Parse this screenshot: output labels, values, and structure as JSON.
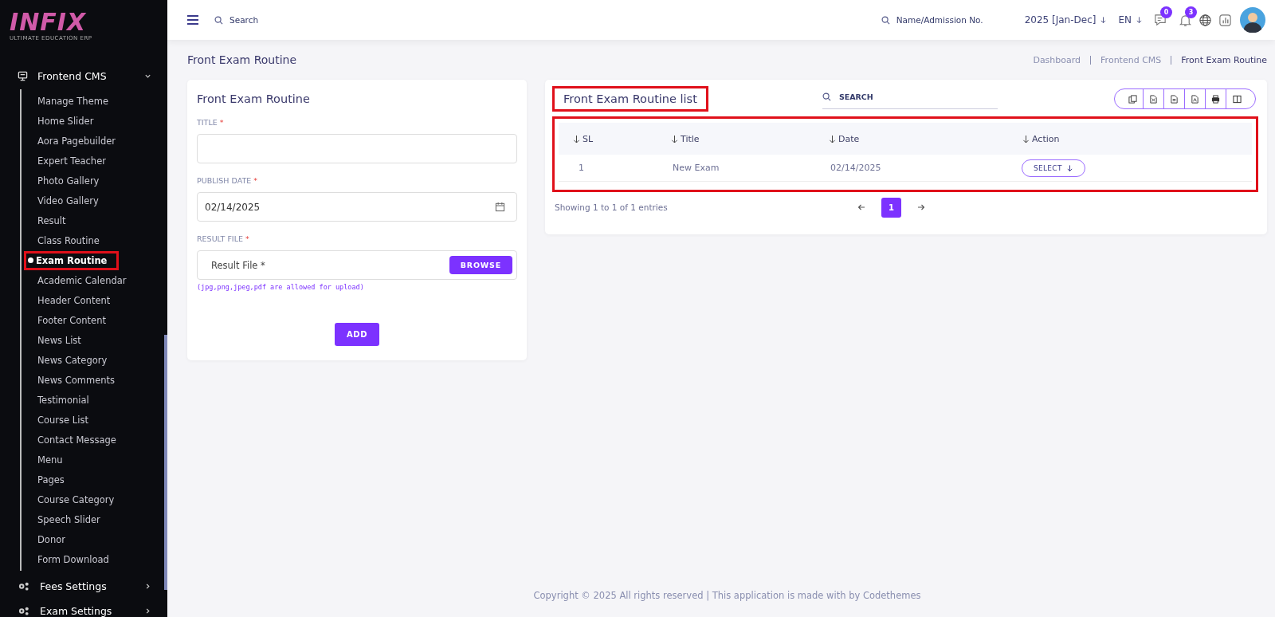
{
  "logo": {
    "name": "INFIX",
    "tagline": "ULTIMATE EDUCATION ERP"
  },
  "topbar": {
    "search_placeholder": "Search",
    "student_search_placeholder": "Name/Admission No.",
    "session": "2025 [Jan-Dec]",
    "language": "EN",
    "messages_badge": "0",
    "notifications_badge": "3"
  },
  "sidebar": {
    "groups": [
      {
        "label": "Frontend CMS",
        "expanded": true,
        "children": [
          {
            "label": "Manage Theme",
            "selected": false,
            "highlighted": false
          },
          {
            "label": "Home Slider",
            "selected": false,
            "highlighted": false
          },
          {
            "label": "Aora Pagebuilder",
            "selected": false,
            "highlighted": false
          },
          {
            "label": "Expert Teacher",
            "selected": false,
            "highlighted": false
          },
          {
            "label": "Photo Gallery",
            "selected": false,
            "highlighted": false
          },
          {
            "label": "Video Gallery",
            "selected": false,
            "highlighted": false
          },
          {
            "label": "Result",
            "selected": false,
            "highlighted": false
          },
          {
            "label": "Class Routine",
            "selected": false,
            "highlighted": false
          },
          {
            "label": "Exam Routine",
            "selected": true,
            "highlighted": true
          },
          {
            "label": "Academic Calendar",
            "selected": false,
            "highlighted": false
          },
          {
            "label": "Header Content",
            "selected": false,
            "highlighted": false
          },
          {
            "label": "Footer Content",
            "selected": false,
            "highlighted": false
          },
          {
            "label": "News List",
            "selected": false,
            "highlighted": false
          },
          {
            "label": "News Category",
            "selected": false,
            "highlighted": false
          },
          {
            "label": "News Comments",
            "selected": false,
            "highlighted": false
          },
          {
            "label": "Testimonial",
            "selected": false,
            "highlighted": false
          },
          {
            "label": "Course List",
            "selected": false,
            "highlighted": false
          },
          {
            "label": "Contact Message",
            "selected": false,
            "highlighted": false
          },
          {
            "label": "Menu",
            "selected": false,
            "highlighted": false
          },
          {
            "label": "Pages",
            "selected": false,
            "highlighted": false
          },
          {
            "label": "Course Category",
            "selected": false,
            "highlighted": false
          },
          {
            "label": "Speech Slider",
            "selected": false,
            "highlighted": false
          },
          {
            "label": "Donor",
            "selected": false,
            "highlighted": false
          },
          {
            "label": "Form Download",
            "selected": false,
            "highlighted": false
          }
        ]
      },
      {
        "label": "Fees Settings",
        "expanded": false
      },
      {
        "label": "Exam Settings",
        "expanded": false
      }
    ]
  },
  "page": {
    "title": "Front Exam Routine",
    "breadcrumb": [
      "Dashboard",
      "Frontend CMS",
      "Front Exam Routine"
    ]
  },
  "form": {
    "title": "Front Exam Routine",
    "fields": [
      {
        "kind": "text",
        "label": "TITLE",
        "required_mark": "*"
      },
      {
        "kind": "date",
        "label": "PUBLISH DATE",
        "required_mark": "*",
        "value": "02/14/2025"
      },
      {
        "kind": "file",
        "label": "RESULT FILE",
        "required_mark": "*",
        "placeholder": "Result File *",
        "button": "BROWSE",
        "hint": "(jpg,png,jpeg,pdf are allowed for upload)"
      }
    ],
    "submit": "ADD"
  },
  "list": {
    "title": "Front Exam Routine list",
    "title_highlighted": true,
    "search_placeholder": "SEARCH",
    "table_highlighted": true,
    "columns": [
      "SL",
      "Title",
      "Date",
      "Action"
    ],
    "rows": [
      {
        "cells": [
          "1",
          "New Exam",
          "02/14/2025"
        ],
        "action": "SELECT"
      }
    ],
    "info": "Showing 1 to 1 of 1 entries",
    "pages": [
      {
        "label": "1",
        "selected": true
      }
    ]
  },
  "footer": "Copyright © 2025 All rights reserved | This application is made with by Codethemes"
}
